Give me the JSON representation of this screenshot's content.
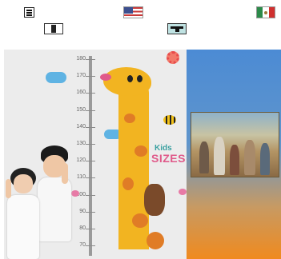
{
  "toolbar": {
    "menu_icon": "hamburger-menu-icon",
    "lang_en_icon": "us-flag-icon",
    "lang_es_icon": "mexico-flag-icon",
    "print_icon": "print-icon",
    "display_icon": "display-mode-icon"
  },
  "content": {
    "height_chart": {
      "ruler_ticks": [
        "180",
        "170",
        "160",
        "150",
        "140",
        "130",
        "120",
        "110",
        "100",
        "90",
        "80",
        "70"
      ],
      "kids_label": "Kids",
      "sizes_label": "SIZES"
    }
  },
  "colors": {
    "background": "#ffffff",
    "panel_blue": "#4c8bd4",
    "panel_orange": "#f08a1e",
    "giraffe_yellow": "#f2b421",
    "display_button_bg": "#bfe2e2"
  }
}
